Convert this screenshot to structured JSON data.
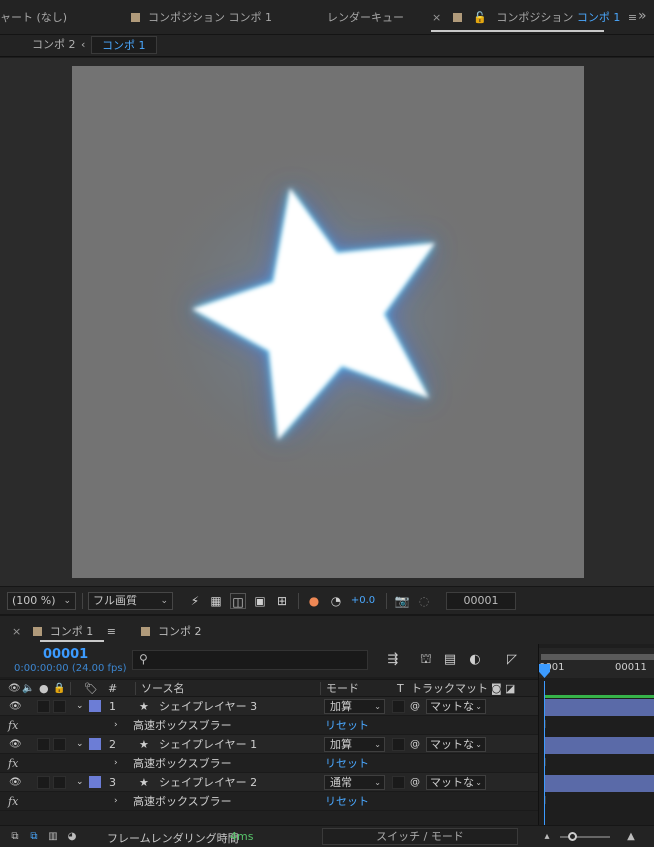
{
  "top_tabs": {
    "flowchart": "ャート (なし)",
    "comp_tab_1": "コンポジション コンポ 1",
    "render_queue": "レンダーキュー",
    "active_prefix": "コンポジション",
    "active_name": "コンポ 1",
    "close": "×",
    "menu": "≡",
    "overflow": "»"
  },
  "breadcrumb": {
    "item1": "コンポ 2",
    "arrow": "‹",
    "item2": "コンポ 1"
  },
  "viewer_toolbar": {
    "zoom": "(100 %)",
    "resolution": "フル画質",
    "exposure": "+0.0",
    "frame": "00001"
  },
  "timeline_tabs": {
    "comp1": "コンポ 1",
    "comp2": "コンポ 2",
    "menu": "≡",
    "close": "×"
  },
  "timeline": {
    "timecode": "00001",
    "fps_line": "0:00:00:00 (24.00 fps)",
    "search_placeholder": "",
    "columns": {
      "number": "#",
      "source": "ソース名",
      "mode": "モード",
      "t": "T",
      "track_matte": "トラックマット"
    },
    "ruler_ticks": [
      "0001",
      "00011"
    ],
    "layers": [
      {
        "num": "1",
        "name": "シェイプレイヤー 3",
        "mode": "加算",
        "matte": "マットな",
        "effect": "高速ボックスブラー",
        "reset": "リセット"
      },
      {
        "num": "2",
        "name": "シェイプレイヤー 1",
        "mode": "加算",
        "matte": "マットな",
        "effect": "高速ボックスブラー",
        "reset": "リセット"
      },
      {
        "num": "3",
        "name": "シェイプレイヤー 2",
        "mode": "通常",
        "matte": "マットな",
        "effect": "高速ボックスブラー",
        "reset": "リセット"
      }
    ],
    "fx_label": "fx"
  },
  "status_bar": {
    "render_time_label": "フレームレンダリング時間",
    "render_time_value": "4ms",
    "switch_mode": "スイッチ / モード"
  },
  "colors": {
    "accent": "#3c9bff",
    "layer_label": "#6c7dd6",
    "layer_bar": "#5a6aa8",
    "canvas_bg": "#737373",
    "star_glow": "#4fd8ff"
  }
}
